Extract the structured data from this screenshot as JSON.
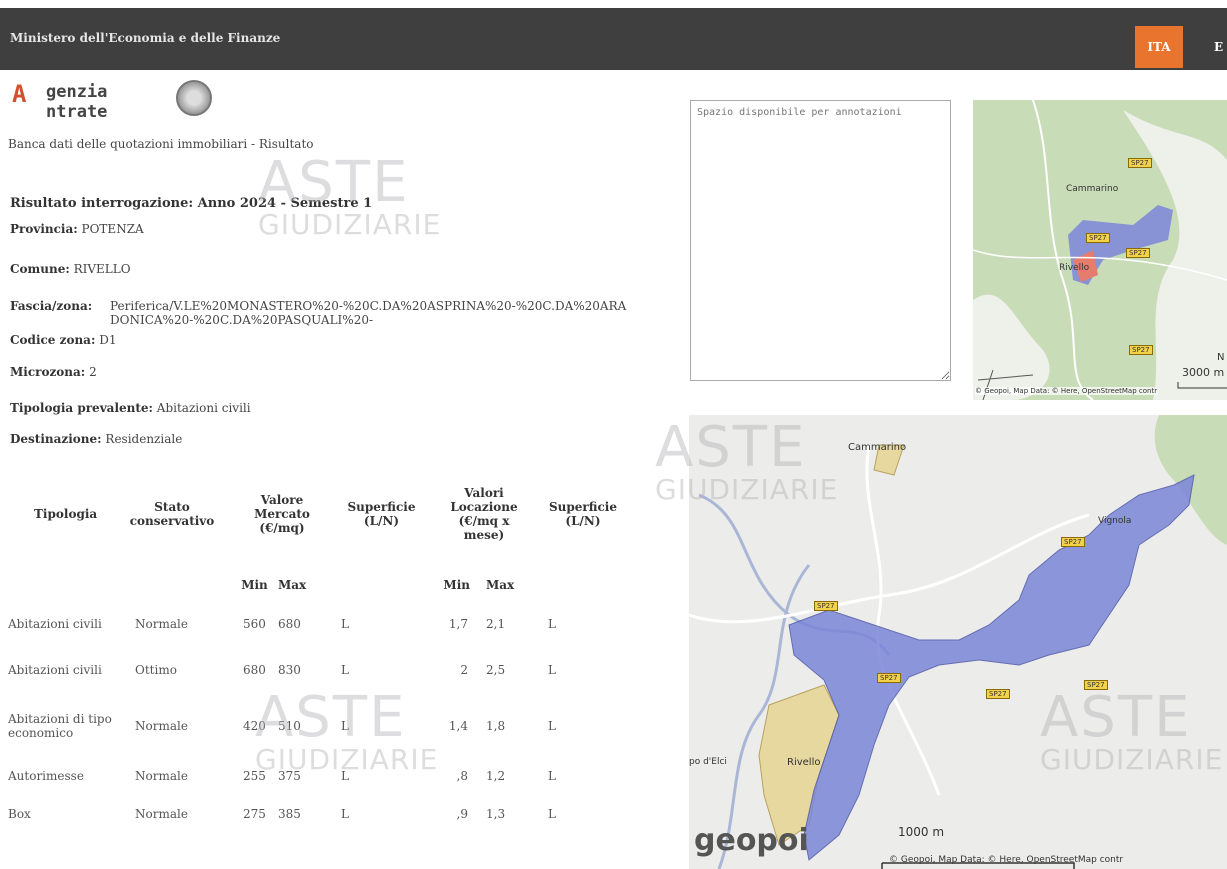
{
  "header": {
    "title": "Ministero dell'Economia e delle Finanze",
    "lang_active": "ITA",
    "lang_other": "E"
  },
  "logo": {
    "line1": "genzia",
    "line2": "ntrate",
    "initial": "A"
  },
  "subtitle": "Banca dati delle quotazioni immobiliari - Risultato",
  "result": {
    "title": "Risultato interrogazione: Anno 2024 - Semestre 1",
    "provincia_label": "Provincia:",
    "provincia_value": "POTENZA",
    "comune_label": "Comune:",
    "comune_value": "RIVELLO",
    "fascia_label": "Fascia/zona:",
    "fascia_value": "Periferica/V.LE%20MONASTERO%20-%20C.DA%20ASPRINA%20-%20C.DA%20ARA DONICA%20-%20C.DA%20PASQUALI%20-",
    "codice_label": "Codice zona:",
    "codice_value": "D1",
    "microzona_label": "Microzona:",
    "microzona_value": "2",
    "tipologia_label": "Tipologia prevalente:",
    "tipologia_value": "Abitazioni civili",
    "destinazione_label": "Destinazione:",
    "destinazione_value": "Residenziale"
  },
  "annotations": {
    "placeholder": "Spazio disponibile per annotazioni"
  },
  "table": {
    "headers": {
      "tipologia": "Tipologia",
      "stato": "Stato conservativo",
      "valore_mercato": "Valore Mercato (€/mq)",
      "superficie1": "Superficie (L/N)",
      "valori_locazione": "Valori Locazione (€/mq x mese)",
      "superficie2": "Superficie (L/N)",
      "min1": "Min",
      "max1": "Max",
      "min2": "Min",
      "max2": "Max"
    },
    "rows": [
      {
        "tipologia": "Abitazioni civili",
        "stato": "Normale",
        "vm_min": "560",
        "vm_max": "680",
        "sup1": "L",
        "vl_min": "1,7",
        "vl_max": "2,1",
        "sup2": "L"
      },
      {
        "tipologia": "Abitazioni civili",
        "stato": "Ottimo",
        "vm_min": "680",
        "vm_max": "830",
        "sup1": "L",
        "vl_min": "2",
        "vl_max": "2,5",
        "sup2": "L"
      },
      {
        "tipologia": "Abitazioni di tipo economico",
        "stato": "Normale",
        "vm_min": "420",
        "vm_max": "510",
        "sup1": "L",
        "vl_min": "1,4",
        "vl_max": "1,8",
        "sup2": "L"
      },
      {
        "tipologia": "Autorimesse",
        "stato": "Normale",
        "vm_min": "255",
        "vm_max": "375",
        "sup1": "L",
        "vl_min": ",8",
        "vl_max": "1,2",
        "sup2": "L"
      },
      {
        "tipologia": "Box",
        "stato": "Normale",
        "vm_min": "275",
        "vm_max": "385",
        "sup1": "L",
        "vl_min": ",9",
        "vl_max": "1,3",
        "sup2": "L"
      }
    ]
  },
  "map_small": {
    "labels": {
      "cammarino": "Cammarino",
      "rivello": "Rivello",
      "n": "N"
    },
    "roads": [
      "SP27",
      "SP27",
      "SP27",
      "SP27"
    ],
    "scale": "3000 m",
    "credits": "© Geopoi, Map Data: © Here, OpenStreetMap contr"
  },
  "map_big": {
    "labels": {
      "cammarino": "Cammarino",
      "rivello": "Rivello",
      "vignola": "Vignola",
      "campo": "po d'Elci"
    },
    "roads": [
      "SP27",
      "SP27",
      "SP27",
      "SP27",
      "SP27"
    ],
    "scale": "1000 m",
    "brand": "geopoi",
    "credits": "© Geopoi, Map Data: © Here, OpenStreetMap contr"
  },
  "watermark": {
    "line1": "ASTE",
    "line2": "GIUDIZIARIE"
  },
  "colors": {
    "topbar": "#3f3f3f",
    "lang_active": "#e8742d",
    "zone_fill": "#7b86d8",
    "zone_rivello": "#e7d8a0"
  }
}
